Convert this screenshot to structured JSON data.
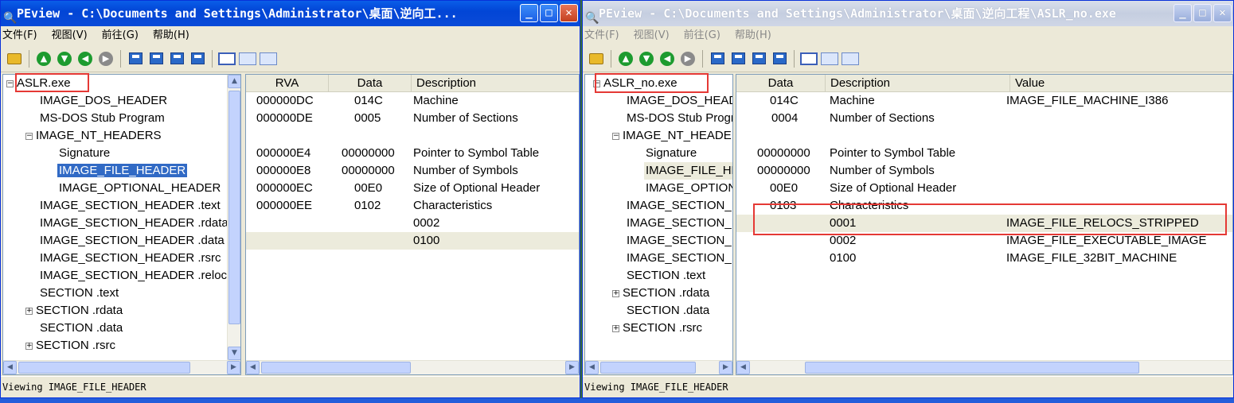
{
  "colors": {
    "titlebar_active": "#0a4bd8",
    "selection": "#316ac5",
    "highlight_box": "#e53935"
  },
  "left": {
    "title": "PEview - C:\\Documents and Settings\\Administrator\\桌面\\逆向工...",
    "menu": [
      "文件(F)",
      "视图(V)",
      "前往(G)",
      "帮助(H)"
    ],
    "tree": {
      "root": "ASLR.exe",
      "items": [
        "IMAGE_DOS_HEADER",
        "MS-DOS Stub Program",
        "IMAGE_NT_HEADERS",
        "Signature",
        "IMAGE_FILE_HEADER",
        "IMAGE_OPTIONAL_HEADER",
        "IMAGE_SECTION_HEADER .text",
        "IMAGE_SECTION_HEADER .rdata",
        "IMAGE_SECTION_HEADER .data",
        "IMAGE_SECTION_HEADER .rsrc",
        "IMAGE_SECTION_HEADER .reloc",
        "SECTION .text",
        "SECTION .rdata",
        "SECTION .data",
        "SECTION .rsrc"
      ]
    },
    "grid": {
      "headers": [
        "RVA",
        "Data",
        "Description"
      ],
      "rows": [
        [
          "000000DC",
          "014C",
          "Machine"
        ],
        [
          "000000DE",
          "0005",
          "Number of Sections"
        ],
        [
          "",
          "",
          ""
        ],
        [
          "000000E4",
          "00000000",
          "Pointer to Symbol Table"
        ],
        [
          "000000E8",
          "00000000",
          "Number of Symbols"
        ],
        [
          "000000EC",
          "00E0",
          "Size of Optional Header"
        ],
        [
          "000000EE",
          "0102",
          "Characteristics"
        ],
        [
          "",
          "",
          "0002"
        ],
        [
          "",
          "",
          "0100"
        ]
      ]
    },
    "status": "Viewing IMAGE_FILE_HEADER"
  },
  "right": {
    "title": "PEview - C:\\Documents and Settings\\Administrator\\桌面\\逆向工程\\ASLR_no.exe",
    "menu": [
      "文件(F)",
      "视图(V)",
      "前往(G)",
      "帮助(H)"
    ],
    "tree": {
      "root": "ASLR_no.exe",
      "items": [
        "IMAGE_DOS_HEADER",
        "MS-DOS Stub Program",
        "IMAGE_NT_HEADERS",
        "Signature",
        "IMAGE_FILE_HEADER",
        "IMAGE_OPTIONAL_HEADER",
        "IMAGE_SECTION_HEADER .text",
        "IMAGE_SECTION_HEADER .rdata",
        "IMAGE_SECTION_HEADER .data",
        "IMAGE_SECTION_HEADER .rsrc",
        "SECTION .text",
        "SECTION .rdata",
        "SECTION .data",
        "SECTION .rsrc"
      ]
    },
    "grid": {
      "headers": [
        "Data",
        "Description",
        "Value"
      ],
      "rows": [
        [
          "014C",
          "Machine",
          "IMAGE_FILE_MACHINE_I386"
        ],
        [
          "0004",
          "Number of Sections",
          ""
        ],
        [
          "",
          "",
          ""
        ],
        [
          "00000000",
          "Pointer to Symbol Table",
          ""
        ],
        [
          "00000000",
          "Number of Symbols",
          ""
        ],
        [
          "00E0",
          "Size of Optional Header",
          ""
        ],
        [
          "0103",
          "Characteristics",
          ""
        ],
        [
          "",
          "0001",
          "IMAGE_FILE_RELOCS_STRIPPED"
        ],
        [
          "",
          "0002",
          "IMAGE_FILE_EXECUTABLE_IMAGE"
        ],
        [
          "",
          "0100",
          "IMAGE_FILE_32BIT_MACHINE"
        ]
      ]
    },
    "status": "Viewing IMAGE_FILE_HEADER"
  }
}
